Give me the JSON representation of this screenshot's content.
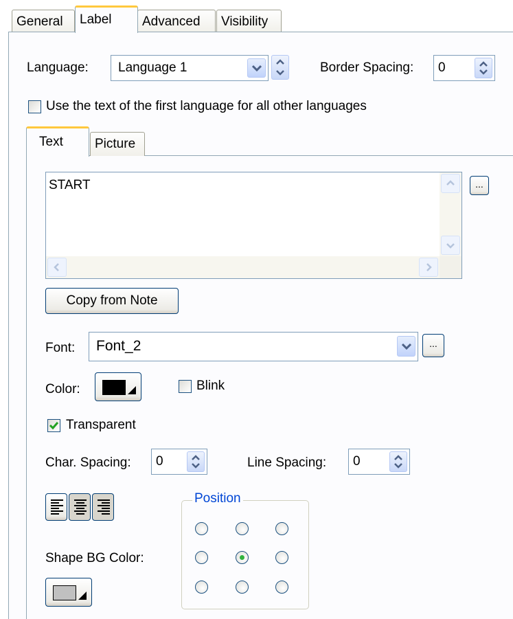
{
  "tabs": [
    {
      "label": "General"
    },
    {
      "label": "Label"
    },
    {
      "label": "Advanced"
    },
    {
      "label": "Visibility"
    }
  ],
  "language": {
    "label": "Language:",
    "value": "Language 1"
  },
  "border_spacing": {
    "label": "Border Spacing:",
    "value": "0"
  },
  "use_first_language": {
    "label": "Use the text of the first language for all other languages",
    "checked": false
  },
  "sub_tabs": [
    {
      "label": "Text"
    },
    {
      "label": "Picture"
    }
  ],
  "text_area": {
    "value": "START"
  },
  "copy_from_note": {
    "label": "Copy from Note"
  },
  "ellipsis_label": "...",
  "font": {
    "label": "Font:",
    "value": "Font_2"
  },
  "color": {
    "label": "Color:",
    "swatch": "#000000"
  },
  "blink": {
    "label": "Blink",
    "checked": false
  },
  "transparent": {
    "label": "Transparent",
    "checked": true
  },
  "char_spacing": {
    "label": "Char. Spacing:",
    "value": "0"
  },
  "line_spacing": {
    "label": "Line Spacing:",
    "value": "0"
  },
  "alignment": {
    "options": [
      "left-align-icon",
      "center-align-icon",
      "right-align-icon"
    ],
    "selected": "left"
  },
  "position": {
    "legend": "Position",
    "selected": "middle-center"
  },
  "shape_bg_color": {
    "label": "Shape BG Color:",
    "swatch": "#c0c0c0"
  },
  "colors": {
    "accent_tab": "#ffc83c",
    "check_green": "#31b23e",
    "group_title": "#0046d5"
  }
}
